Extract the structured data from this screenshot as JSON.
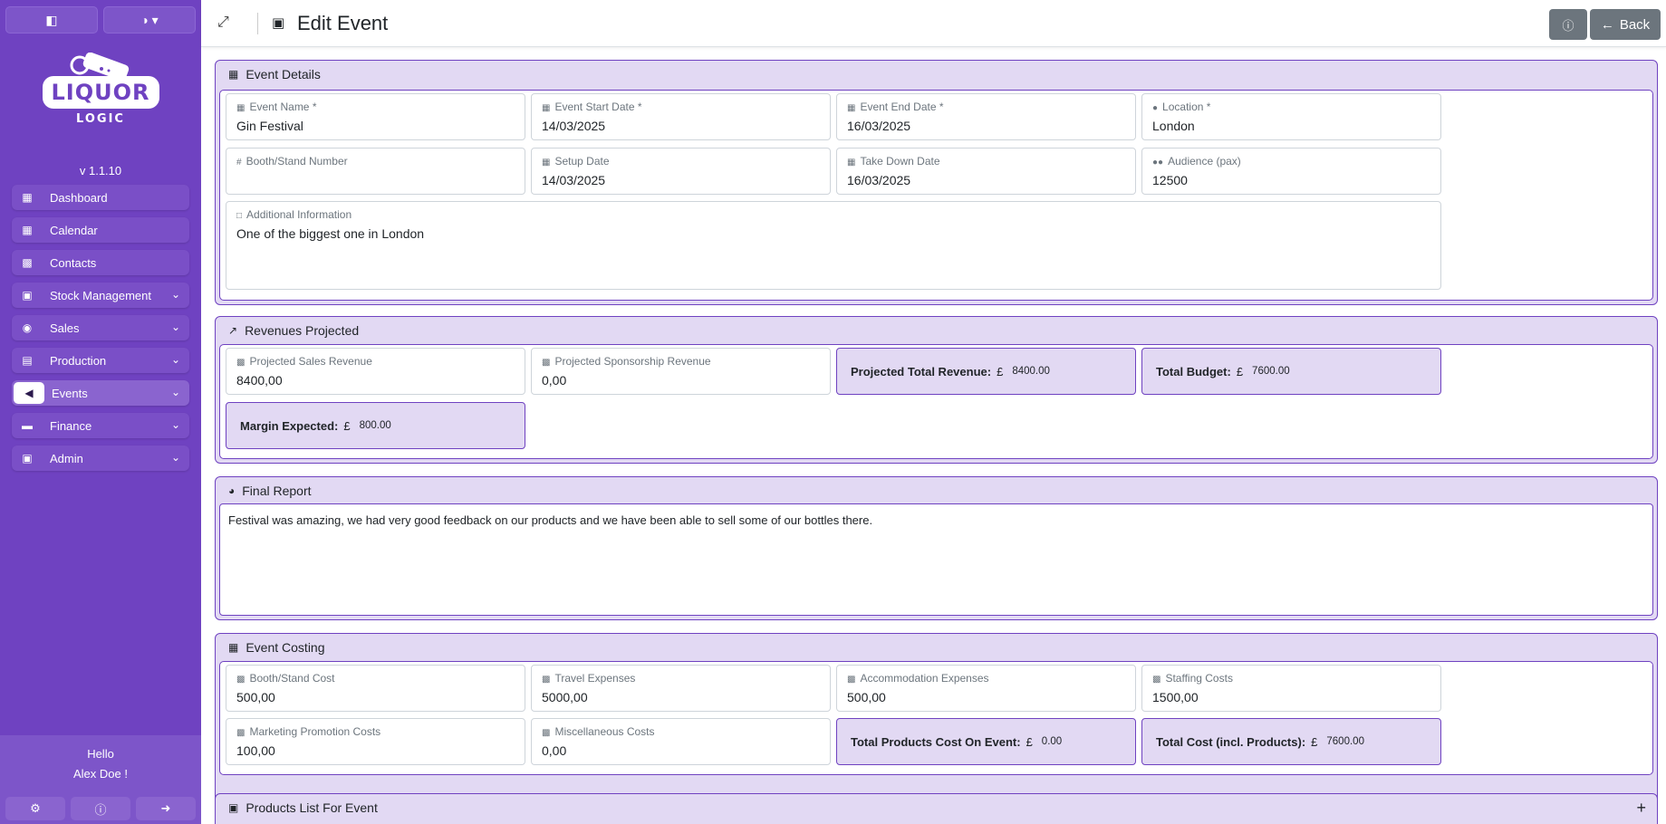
{
  "sidebar": {
    "brand_top": "LIQUOR",
    "brand_bottom": "LOGIC",
    "version": "v 1.1.10",
    "items": [
      {
        "label": "Dashboard",
        "icon": "grid-icon"
      },
      {
        "label": "Calendar",
        "icon": "calendar-check-icon"
      },
      {
        "label": "Contacts",
        "icon": "address-book-icon"
      },
      {
        "label": "Stock Management",
        "icon": "box-icon"
      },
      {
        "label": "Sales",
        "icon": "money-bag-icon"
      },
      {
        "label": "Production",
        "icon": "industry-icon"
      },
      {
        "label": "Events",
        "icon": "megaphone-icon"
      },
      {
        "label": "Finance",
        "icon": "wallet-icon"
      },
      {
        "label": "Admin",
        "icon": "briefcase-icon"
      }
    ],
    "active_item": "Events",
    "hello": "Hello",
    "user_name": "Alex Doe !"
  },
  "header": {
    "title": "Edit Event",
    "back_label": "Back"
  },
  "event_details": {
    "title": "Event Details",
    "event_name": {
      "label": "Event Name *",
      "value": "Gin Festival"
    },
    "start_date": {
      "label": "Event Start Date *",
      "value": "14/03/2025"
    },
    "end_date": {
      "label": "Event End Date *",
      "value": "16/03/2025"
    },
    "location": {
      "label": "Location *",
      "value": "London"
    },
    "booth": {
      "label": "Booth/Stand Number",
      "value": ""
    },
    "setup_date": {
      "label": "Setup Date",
      "value": "14/03/2025"
    },
    "takedown_date": {
      "label": "Take Down Date",
      "value": "16/03/2025"
    },
    "audience": {
      "label": "Audience (pax)",
      "value": "12500"
    },
    "additional": {
      "label": "Additional Information",
      "value": "One of the biggest one in London"
    }
  },
  "revenues": {
    "title": "Revenues Projected",
    "sales_revenue": {
      "label": "Projected Sales Revenue",
      "value": "8400,00"
    },
    "sponsorship_revenue": {
      "label": "Projected Sponsorship Revenue",
      "value": "0,00"
    },
    "total_revenue": {
      "label": "Projected Total Revenue:",
      "currency": "£",
      "value": "8400.00"
    },
    "total_budget": {
      "label": "Total Budget:",
      "currency": "£",
      "value": "7600.00"
    },
    "margin": {
      "label": "Margin Expected:",
      "currency": "£",
      "value": "800.00"
    }
  },
  "final_report": {
    "title": "Final Report",
    "text": "Festival was amazing, we had very good feedback on our products and we have been able to sell some of our bottles there."
  },
  "costing": {
    "title": "Event Costing",
    "booth_cost": {
      "label": "Booth/Stand Cost",
      "value": "500,00"
    },
    "travel": {
      "label": "Travel Expenses",
      "value": "5000,00"
    },
    "accommodation": {
      "label": "Accommodation Expenses",
      "value": "500,00"
    },
    "staffing": {
      "label": "Staffing Costs",
      "value": "1500,00"
    },
    "marketing": {
      "label": "Marketing Promotion Costs",
      "value": "100,00"
    },
    "misc": {
      "label": "Miscellaneous Costs",
      "value": "0,00"
    },
    "products_cost": {
      "label": "Total Products Cost On Event:",
      "currency": "£",
      "value": "0.00"
    },
    "total_cost": {
      "label": "Total Cost (incl. Products):",
      "currency": "£",
      "value": "7600.00"
    }
  },
  "products": {
    "title": "Products List For Event"
  }
}
